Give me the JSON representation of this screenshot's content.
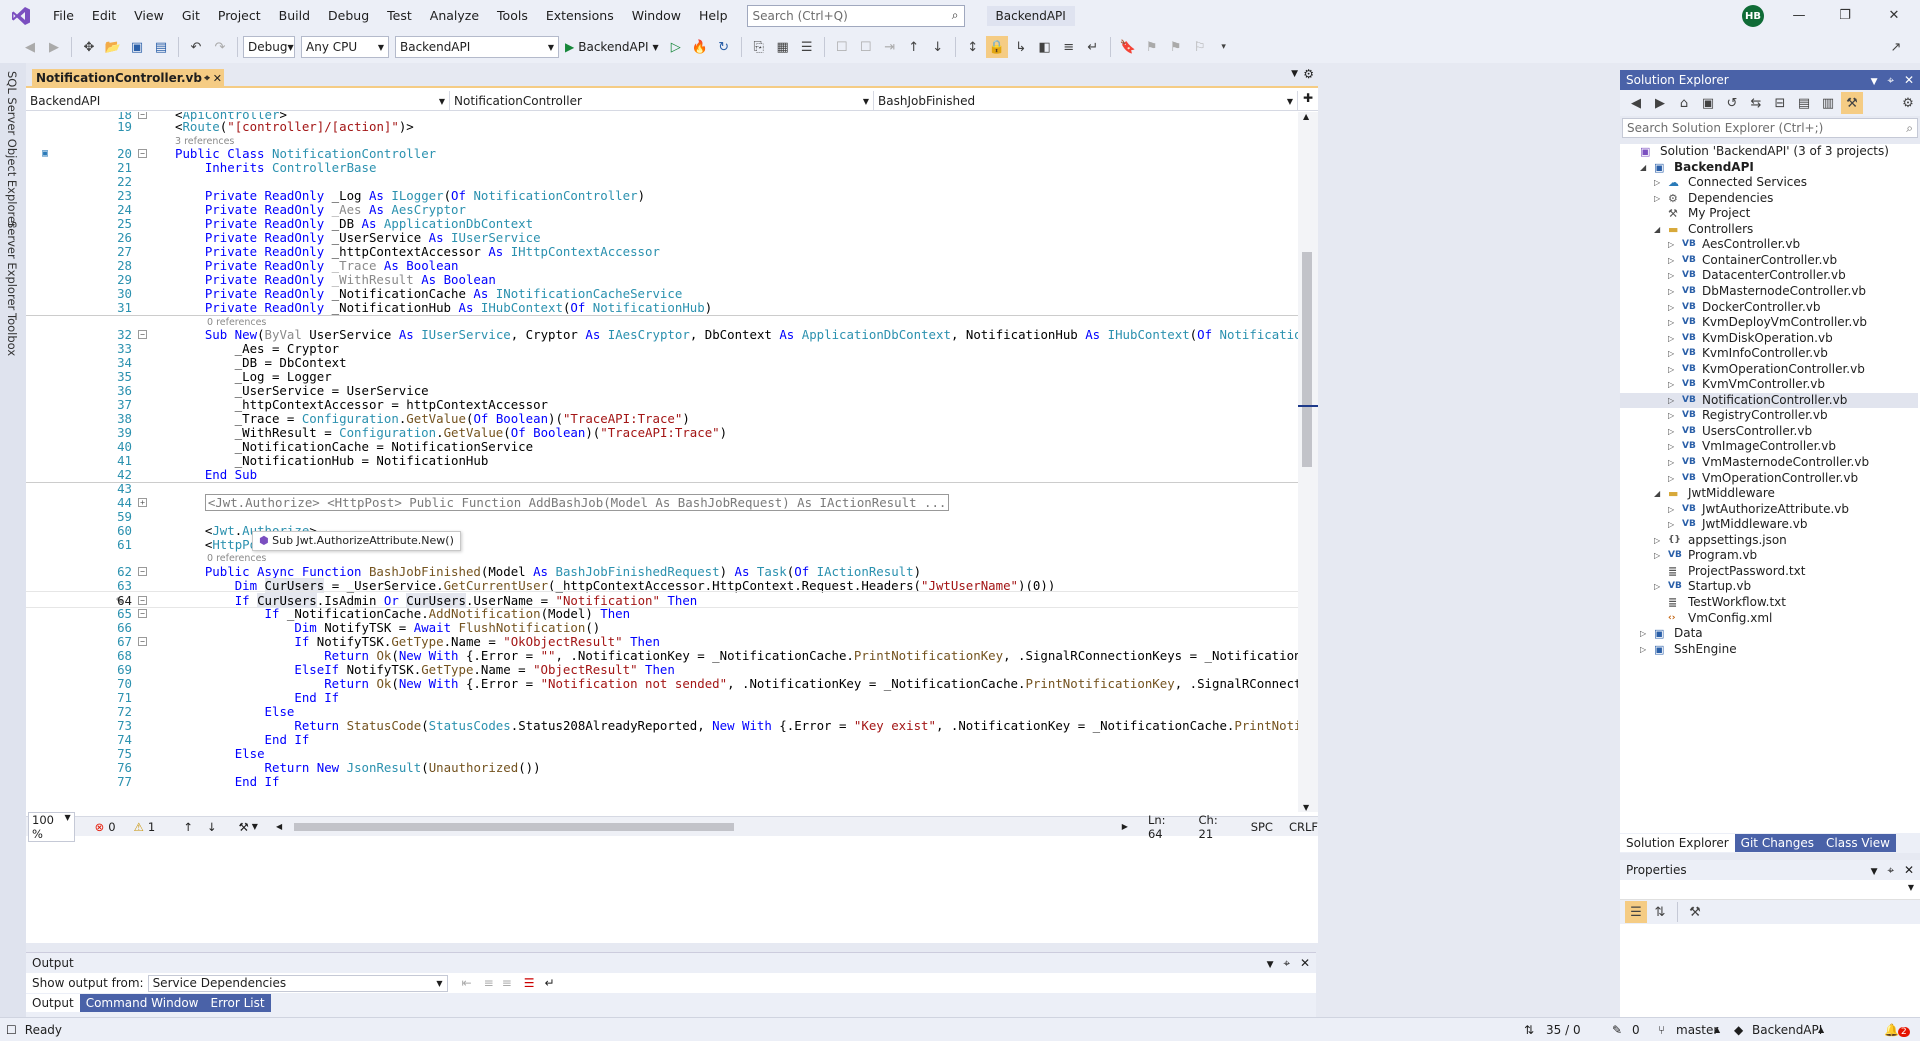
{
  "menu": [
    "File",
    "Edit",
    "View",
    "Git",
    "Project",
    "Build",
    "Debug",
    "Test",
    "Analyze",
    "Tools",
    "Extensions",
    "Window",
    "Help"
  ],
  "search": {
    "placeholder": "Search (Ctrl+Q)"
  },
  "solution_name": "BackendAPI",
  "user_initials": "HB",
  "toolbar": {
    "config": "Debug",
    "platform": "Any CPU",
    "startup_project": "BackendAPI",
    "run_label": "BackendAPI"
  },
  "left_rail": [
    "SQL Server Object Explorer",
    "Server Explorer",
    "Toolbox"
  ],
  "editor": {
    "tab_label": "NotificationController.vb",
    "nav": [
      "BackendAPI",
      "NotificationController",
      "BashJobFinished"
    ],
    "zoom": "100 %",
    "errors": "0",
    "warnings": "1",
    "position": {
      "ln": "Ln: 64",
      "ch": "Ch: 21",
      "enc": "SPC",
      "eol": "CRLF"
    },
    "tooltip": "Sub Jwt.AuthorizeAttribute.New()",
    "refs_3": "3 references",
    "refs_0": "0 references",
    "refs_0b": "0 references",
    "collapsed_44": "<Jwt.Authorize> <HttpPost> Public Function AddBashJob(Model As BashJobRequest) As IActionResult ..."
  },
  "output": {
    "title": "Output",
    "show_from_label": "Show output from:",
    "source": "Service Dependencies",
    "tabs": [
      "Output",
      "Command Window",
      "Error List"
    ]
  },
  "solution_explorer": {
    "title": "Solution Explorer",
    "search_placeholder": "Search Solution Explorer (Ctrl+;)",
    "items": [
      {
        "label": "Solution 'BackendAPI' (3 of 3 projects)",
        "depth": 0,
        "icon": "solution-icon"
      },
      {
        "label": "BackendAPI",
        "depth": 1,
        "icon": "project-icon",
        "bold": true
      },
      {
        "label": "Connected Services",
        "depth": 2,
        "icon": "connected-services-icon"
      },
      {
        "label": "Dependencies",
        "depth": 2,
        "icon": "dependencies-icon"
      },
      {
        "label": "My Project",
        "depth": 2,
        "icon": "wrench-icon"
      },
      {
        "label": "Controllers",
        "depth": 2,
        "icon": "folder-icon"
      },
      {
        "label": "AesController.vb",
        "depth": 3,
        "icon": "vb-file-icon"
      },
      {
        "label": "ContainerController.vb",
        "depth": 3,
        "icon": "vb-file-icon"
      },
      {
        "label": "DatacenterController.vb",
        "depth": 3,
        "icon": "vb-file-icon"
      },
      {
        "label": "DbMasternodeController.vb",
        "depth": 3,
        "icon": "vb-file-icon"
      },
      {
        "label": "DockerController.vb",
        "depth": 3,
        "icon": "vb-file-icon"
      },
      {
        "label": "KvmDeployVmController.vb",
        "depth": 3,
        "icon": "vb-file-icon"
      },
      {
        "label": "KvmDiskOperation.vb",
        "depth": 3,
        "icon": "vb-file-icon"
      },
      {
        "label": "KvmInfoController.vb",
        "depth": 3,
        "icon": "vb-file-icon"
      },
      {
        "label": "KvmOperationController.vb",
        "depth": 3,
        "icon": "vb-file-icon"
      },
      {
        "label": "KvmVmController.vb",
        "depth": 3,
        "icon": "vb-file-icon"
      },
      {
        "label": "NotificationController.vb",
        "depth": 3,
        "icon": "vb-file-icon",
        "selected": true
      },
      {
        "label": "RegistryController.vb",
        "depth": 3,
        "icon": "vb-file-icon"
      },
      {
        "label": "UsersController.vb",
        "depth": 3,
        "icon": "vb-file-icon"
      },
      {
        "label": "VmImageController.vb",
        "depth": 3,
        "icon": "vb-file-icon"
      },
      {
        "label": "VmMasternodeController.vb",
        "depth": 3,
        "icon": "vb-file-icon"
      },
      {
        "label": "VmOperationController.vb",
        "depth": 3,
        "icon": "vb-file-icon"
      },
      {
        "label": "JwtMiddleware",
        "depth": 2,
        "icon": "folder-icon"
      },
      {
        "label": "JwtAuthorizeAttribute.vb",
        "depth": 3,
        "icon": "vb-file-icon"
      },
      {
        "label": "JwtMiddleware.vb",
        "depth": 3,
        "icon": "vb-file-icon"
      },
      {
        "label": "appsettings.json",
        "depth": 2,
        "icon": "json-file-icon"
      },
      {
        "label": "Program.vb",
        "depth": 2,
        "icon": "vb-file-icon"
      },
      {
        "label": "ProjectPassword.txt",
        "depth": 2,
        "icon": "text-file-icon"
      },
      {
        "label": "Startup.vb",
        "depth": 2,
        "icon": "vb-file-icon"
      },
      {
        "label": "TestWorkflow.txt",
        "depth": 2,
        "icon": "text-file-icon"
      },
      {
        "label": "VmConfig.xml",
        "depth": 2,
        "icon": "xml-file-icon"
      },
      {
        "label": "Data",
        "depth": 1,
        "icon": "project-icon"
      },
      {
        "label": "SshEngine",
        "depth": 1,
        "icon": "project-icon"
      }
    ],
    "tabs": [
      "Solution Explorer",
      "Git Changes",
      "Class View"
    ]
  },
  "properties": {
    "title": "Properties"
  },
  "status": {
    "ready": "Ready",
    "git_changes": "35 / 0",
    "pending": "0",
    "branch": "master",
    "repo": "BackendAPI",
    "notifications": "2"
  }
}
